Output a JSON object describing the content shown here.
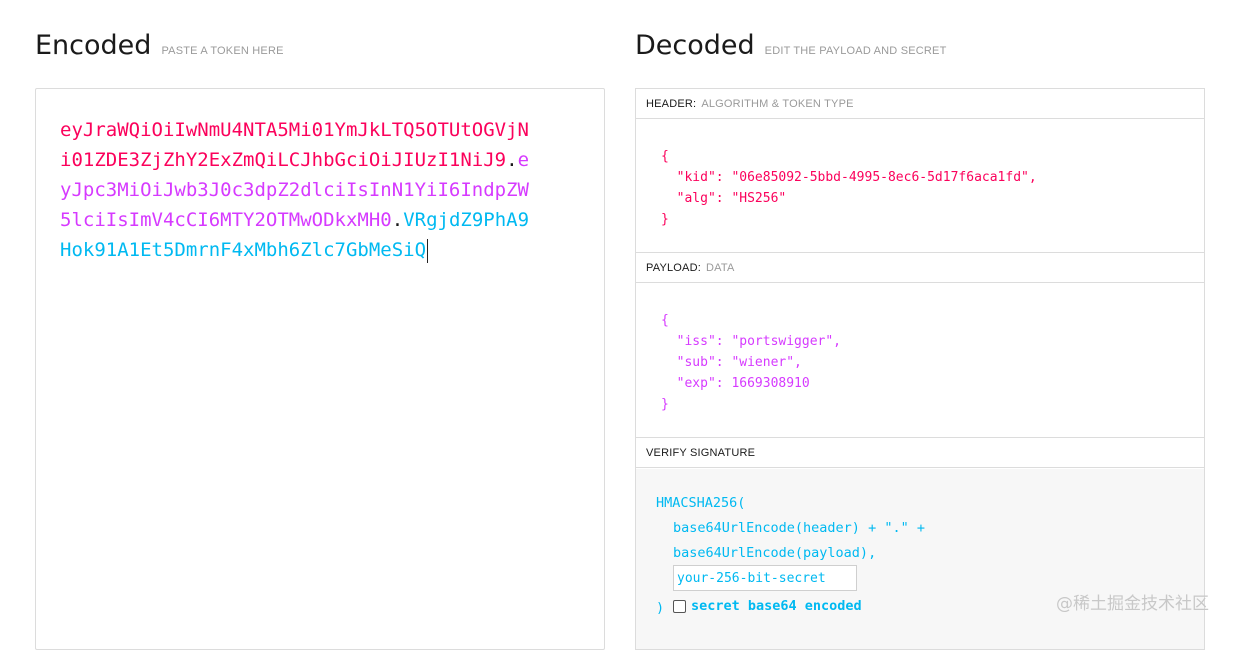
{
  "encoded": {
    "title": "Encoded",
    "subtitle": "PASTE A TOKEN HERE",
    "token_header": "eyJraWQiOiIwNmU4NTA5Mi01YmJkLTQ5OTUtOGVjNi01ZDE3ZjZhY2ExZmQiLCJhbGciOiJIUzI1NiJ9",
    "dot1": ".",
    "token_payload": "eyJpc3MiOiJwb3J0c3dpZ2dlciIsInN1YiI6IndpZW5lciIsImV4cCI6MTY2OTMwODkxMH0",
    "dot2": ".",
    "token_signature": "VRgjdZ9PhA9Hok91A1Et5DmrnF4xMbh6Zlc7GbMeSiQ"
  },
  "decoded": {
    "title": "Decoded",
    "subtitle": "EDIT THE PAYLOAD AND SECRET",
    "header_section": {
      "label": "HEADER:",
      "sublabel": "ALGORITHM & TOKEN TYPE",
      "lines": [
        "{",
        "  \"kid\": \"06e85092-5bbd-4995-8ec6-5d17f6aca1fd\",",
        "  \"alg\": \"HS256\"",
        "}"
      ]
    },
    "payload_section": {
      "label": "PAYLOAD:",
      "sublabel": "DATA",
      "lines": [
        "{",
        "  \"iss\": \"portswigger\",",
        "  \"sub\": \"wiener\",",
        "  \"exp\": 1669308910",
        "}"
      ]
    },
    "verify_section": {
      "label": "VERIFY SIGNATURE",
      "line1": "HMACSHA256(",
      "line2": "base64UrlEncode(header) + \".\" +",
      "line3": "base64UrlEncode(payload),",
      "secret_placeholder": "your-256-bit-secret",
      "close": ")",
      "checkbox_label": "secret base64 encoded",
      "checkbox_checked": false
    }
  },
  "watermark": "@稀土掘金技术社区",
  "colors": {
    "header": "#fb015b",
    "payload": "#d63aff",
    "signature": "#00b9f1"
  }
}
